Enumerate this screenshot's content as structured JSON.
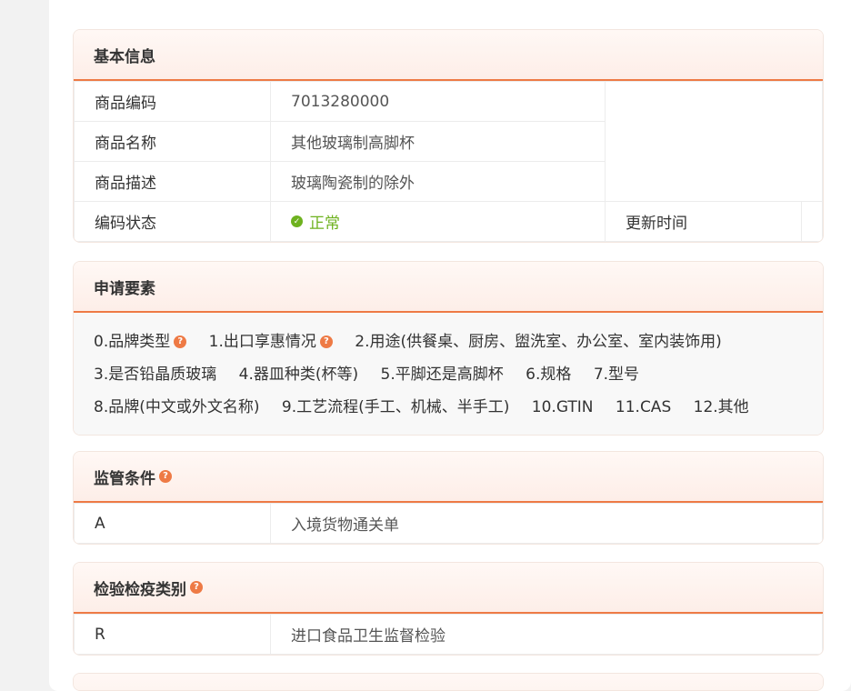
{
  "basic_info": {
    "title": "基本信息",
    "rows": [
      {
        "label": "商品编码",
        "value": "7013280000"
      },
      {
        "label": "商品名称",
        "value": "其他玻璃制高脚杯"
      },
      {
        "label": "商品描述",
        "value": "玻璃陶瓷制的除外"
      }
    ],
    "status_label": "编码状态",
    "status_value": "正常",
    "status_color": "#6eb21f",
    "update_label": "更新时间",
    "update_value": ""
  },
  "declaration": {
    "title": "申请要素",
    "line1": [
      "0.品牌类型",
      "1.出口享惠情况",
      "2.用途(供餐桌、厨房、盥洗室、办公室、室内装饰用)"
    ],
    "line2": [
      "3.是否铅晶质玻璃",
      "4.器皿种类(杯等)",
      "5.平脚还是高脚杯",
      "6.规格",
      "7.型号"
    ],
    "line3": [
      "8.品牌(中文或外文名称)",
      "9.工艺流程(手工、机械、半手工)",
      "10.GTIN",
      "11.CAS",
      "12.其他"
    ]
  },
  "supervision": {
    "title": "监管条件",
    "code": "A",
    "desc": "入境货物通关单"
  },
  "inspection": {
    "title": "检验检疫类别",
    "code": "R",
    "desc": "进口食品卫生监督检验"
  },
  "colors": {
    "accent": "#ee7a45",
    "header_bg": "#fdeee8"
  },
  "icons": {
    "help": "question-circle-icon",
    "status": "check-circle-icon"
  }
}
